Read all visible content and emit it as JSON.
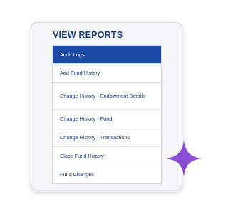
{
  "panel": {
    "title": "VIEW REPORTS"
  },
  "menu": {
    "items": [
      {
        "label": "Audit Logs",
        "active": true
      },
      {
        "label": "Add Fund History",
        "active": false
      },
      {
        "label": "Change History - Endowment Details",
        "active": false
      },
      {
        "label": "Change History - Fund",
        "active": false
      },
      {
        "label": "Change History - Transactions",
        "active": false
      },
      {
        "label": "Close Fund History",
        "active": false
      },
      {
        "label": "Fund Changes",
        "active": false
      }
    ]
  },
  "colors": {
    "accent": "#1a4aa6",
    "title": "#1f3f7f",
    "sparkle": "#8a4dd4"
  },
  "decoration": {
    "sparkle_icon": "four-point-star"
  }
}
